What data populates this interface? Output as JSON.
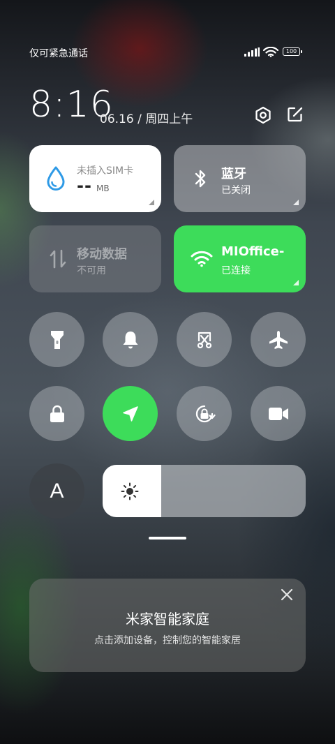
{
  "status_bar": {
    "carrier_text": "仅可紧急通话",
    "battery": "100"
  },
  "header": {
    "time": "8:16",
    "date": "06.16 / 周四上午"
  },
  "tiles": {
    "data": {
      "title": "未插入SIM卡",
      "value": "--",
      "unit": "MB"
    },
    "bluetooth": {
      "title": "蓝牙",
      "status": "已关闭"
    },
    "mobile_data": {
      "title": "移动数据",
      "status": "不可用"
    },
    "wifi": {
      "title": "MIOffice-",
      "status": "已连接"
    }
  },
  "toggles_row1": [
    "flashlight-icon",
    "bell-icon",
    "screenshot-icon",
    "airplane-icon"
  ],
  "toggles_row2": [
    "lock-icon",
    "location-icon",
    "rotation-lock-icon",
    "video-camera-icon"
  ],
  "brightness": {
    "level": 0.29
  },
  "auto_brightness_label": "A",
  "smart_home": {
    "title": "米家智能家庭",
    "subtitle": "点击添加设备，控制您的智能家居"
  },
  "colors": {
    "accent_green": "#3ddc5a",
    "water_blue": "#2e9ae6"
  }
}
